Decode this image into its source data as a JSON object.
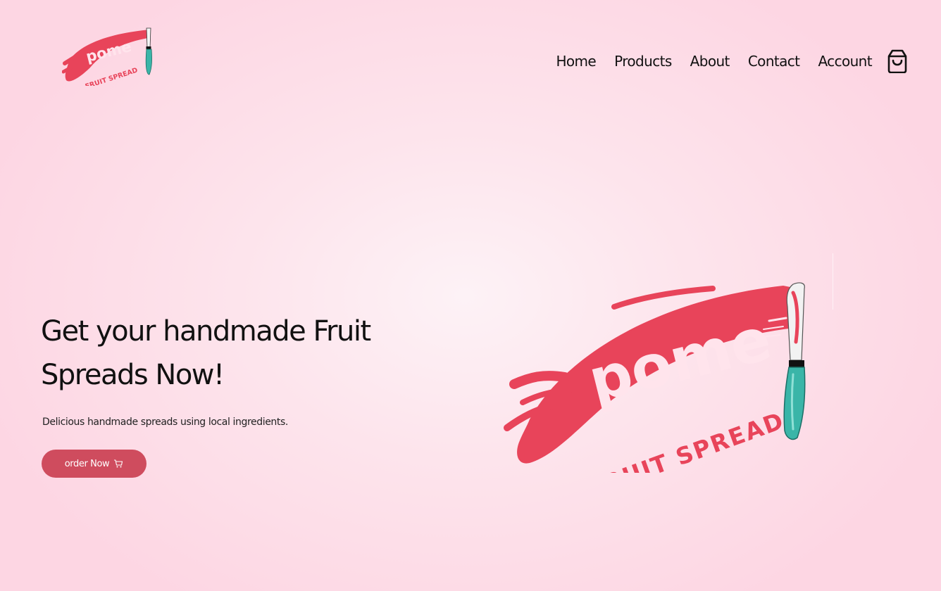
{
  "brand": {
    "name": "pome",
    "tagline": "FRUIT SPREAD",
    "logo_icon": "pome-fruit-spread-logo",
    "colors": {
      "primary": "#e8445a",
      "button": "#cf4c5e",
      "knife_blade": "#3ab5a8",
      "background": "#fdd6e3"
    }
  },
  "nav": {
    "items": [
      {
        "label": "Home"
      },
      {
        "label": "Products"
      },
      {
        "label": "About"
      },
      {
        "label": "Contact"
      },
      {
        "label": "Account"
      }
    ],
    "cart_icon": "shopping-bag-icon"
  },
  "hero": {
    "title": "Get your handmade Fruit Spreads Now!",
    "subtitle": "Delicious handmade spreads using local ingredients.",
    "cta": {
      "label": "order Now",
      "icon": "shopping-cart-icon"
    }
  }
}
